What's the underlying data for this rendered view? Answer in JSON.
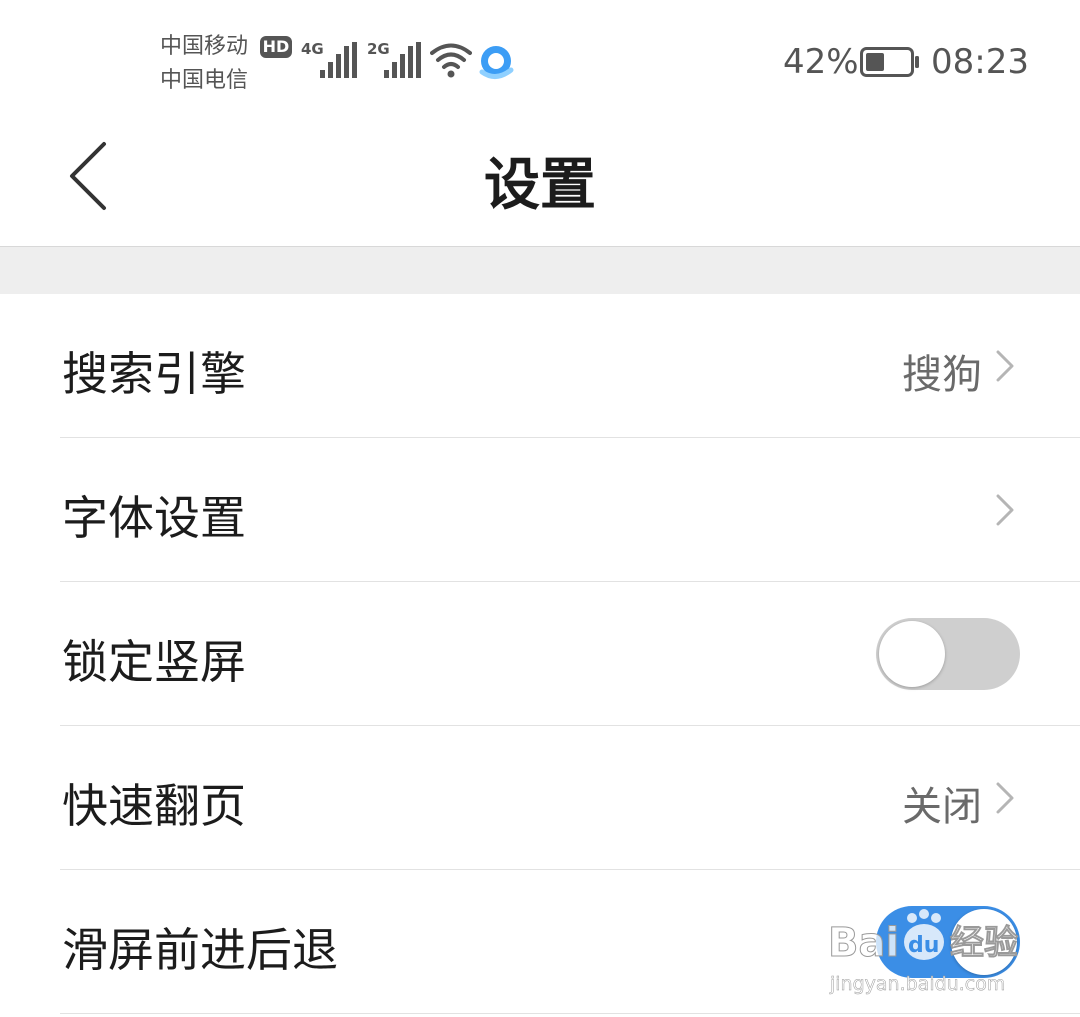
{
  "status_bar": {
    "carrier_1": "中国移动",
    "carrier_2": "中国电信",
    "hd_badge": "HD",
    "network_1": "4G",
    "network_2": "2G",
    "battery_percent": "42%",
    "battery_level": 0.42,
    "time": "08:23"
  },
  "header": {
    "title": "设置"
  },
  "settings": {
    "search_engine": {
      "label": "搜索引擎",
      "value": "搜狗"
    },
    "font_settings": {
      "label": "字体设置"
    },
    "lock_portrait": {
      "label": "锁定竖屏",
      "enabled": false
    },
    "quick_page_turn": {
      "label": "快速翻页",
      "value": "关闭"
    },
    "swipe_navigation": {
      "label": "滑屏前进后退",
      "enabled": true
    }
  },
  "watermark": {
    "brand": "Bai",
    "brand_suffix": "du",
    "cn": "经验",
    "url": "jingyan.baidu.com"
  },
  "colors": {
    "accent": "#3b8ee6",
    "toggle_off": "#cfcfcf",
    "divider": "#e2e2e2",
    "section_gap": "#eeeeee"
  }
}
